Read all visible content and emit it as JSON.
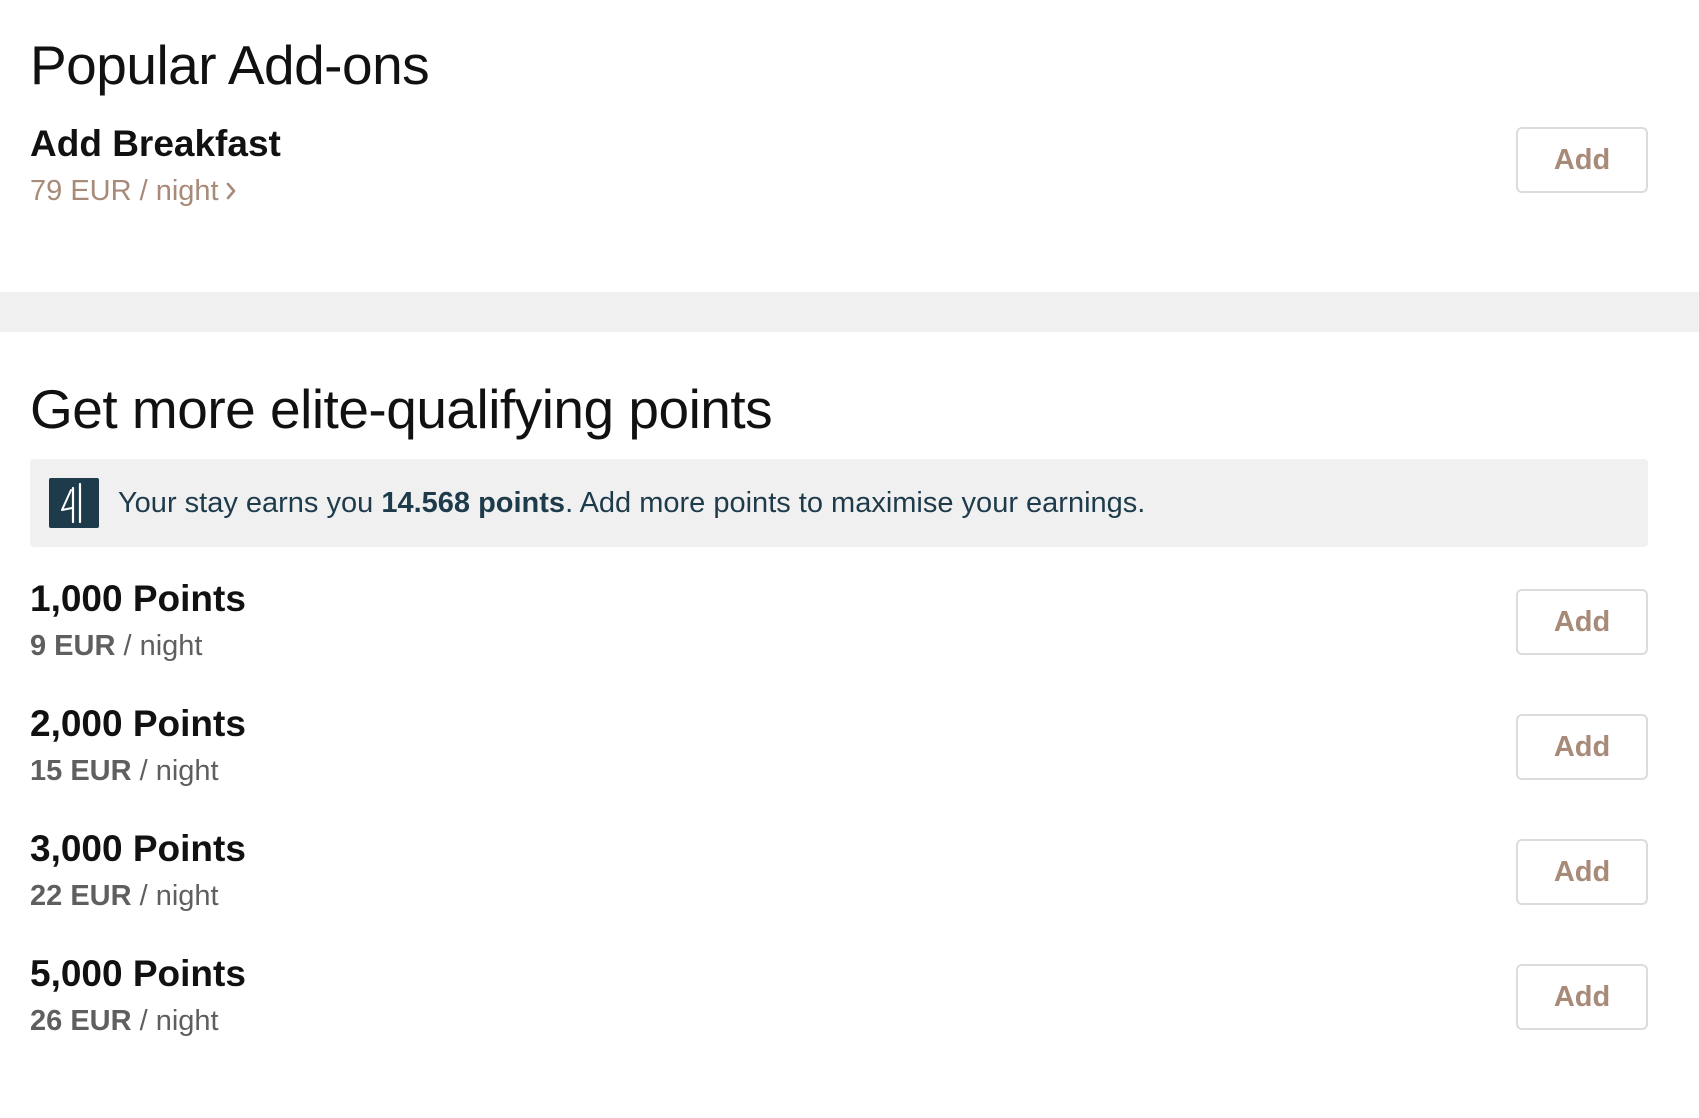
{
  "addons": {
    "title": "Popular Add-ons",
    "breakfast": {
      "title": "Add Breakfast",
      "price": "79 EUR / night",
      "button": "Add"
    }
  },
  "elite": {
    "title": "Get more elite-qualifying points",
    "banner": {
      "prefix": "Your stay earns you ",
      "points": "14.568 points",
      "suffix": ". Add more points to maximise your earnings."
    },
    "options": [
      {
        "title": "1,000 Points",
        "price": "9 EUR",
        "unit": " / night",
        "button": "Add"
      },
      {
        "title": "2,000 Points",
        "price": "15 EUR",
        "unit": " / night",
        "button": "Add"
      },
      {
        "title": "3,000 Points",
        "price": "22 EUR",
        "unit": " / night",
        "button": "Add"
      },
      {
        "title": "5,000 Points",
        "price": "26 EUR",
        "unit": " / night",
        "button": "Add"
      }
    ]
  },
  "colors": {
    "accent": "#a88a79",
    "banner_text": "#1e3b4b",
    "band": "#f0f0f0"
  },
  "icons": {
    "breakfast_link": "chevron-right-icon",
    "banner_logo": "brand-logo-icon"
  }
}
